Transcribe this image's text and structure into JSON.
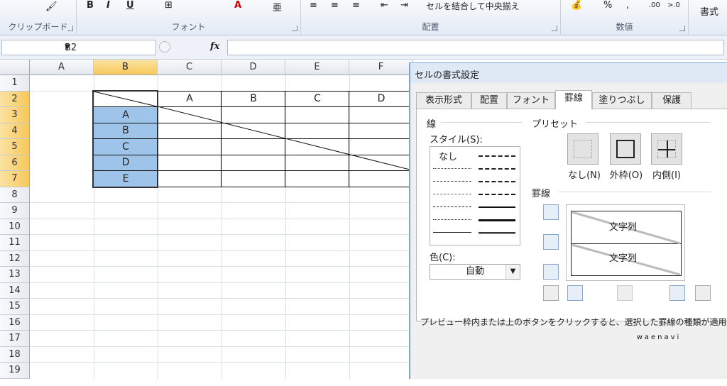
{
  "ribbon": {
    "groups": [
      {
        "label": "クリップボード"
      },
      {
        "label": "フォント"
      },
      {
        "label": "配置"
      },
      {
        "label": "数値"
      }
    ],
    "bold": "B",
    "italic": "I",
    "underline": "U",
    "merge_center": "セルを結合して中央揃え",
    "percent": "%",
    "comma": ",",
    "dec_inc": ".00",
    "dec_dec": ">.0",
    "style_btn": "書式"
  },
  "formula_bar": {
    "name_box": "B2",
    "fx": "fx",
    "value": ""
  },
  "sheet": {
    "columns": [
      "A",
      "B",
      "C",
      "D",
      "E",
      "F"
    ],
    "rows": [
      "1",
      "2",
      "3",
      "4",
      "5",
      "6",
      "7",
      "8",
      "9",
      "10",
      "11",
      "12",
      "13",
      "14",
      "15",
      "16",
      "17",
      "18",
      "19"
    ],
    "selected_col": "B",
    "selected_rows": [
      "2",
      "3",
      "4",
      "5",
      "6",
      "7"
    ],
    "header_row": [
      "A",
      "B",
      "C",
      "D"
    ],
    "row_labels": [
      "A",
      "B",
      "C",
      "D",
      "E"
    ]
  },
  "dialog": {
    "title": "セルの書式設定",
    "tabs": [
      "表示形式",
      "配置",
      "フォント",
      "罫線",
      "塗りつぶし",
      "保護"
    ],
    "active_tab": "罫線",
    "line_section": "線",
    "style_label": "スタイル(S):",
    "none_style": "なし",
    "color_label": "色(C):",
    "color_value": "自動",
    "preset_section": "プリセット",
    "presets": [
      "なし(N)",
      "外枠(O)",
      "内側(I)"
    ],
    "border_section": "罫線",
    "preview_text_1": "文字列",
    "preview_text_2": "文字列",
    "hint": "プレビュー枠内または上のボタンをクリックすると、選択した罫線の種類が適用されます"
  },
  "watermark": "waenavi",
  "colors": {
    "selection_fill": "#9fc4ea",
    "header_highlight": "#f7c75a",
    "dialog_title_bg": "#dfe9f6"
  }
}
